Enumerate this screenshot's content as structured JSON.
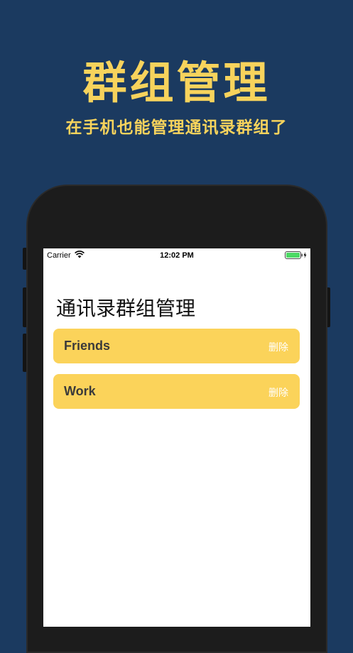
{
  "promo": {
    "title": "群组管理",
    "subtitle": "在手机也能管理通讯录群组了"
  },
  "status_bar": {
    "carrier": "Carrier",
    "time": "12:02 PM",
    "wifi_icon": "wifi-icon",
    "battery_icon": "battery-charging-icon",
    "battery_color": "#4cd964"
  },
  "screen": {
    "title": "通讯录群组管理"
  },
  "groups": [
    {
      "name": "Friends",
      "action": "删除"
    },
    {
      "name": "Work",
      "action": "删除"
    }
  ],
  "colors": {
    "background": "#1b3a60",
    "accent": "#f7d35c",
    "card": "#fbd35a"
  }
}
